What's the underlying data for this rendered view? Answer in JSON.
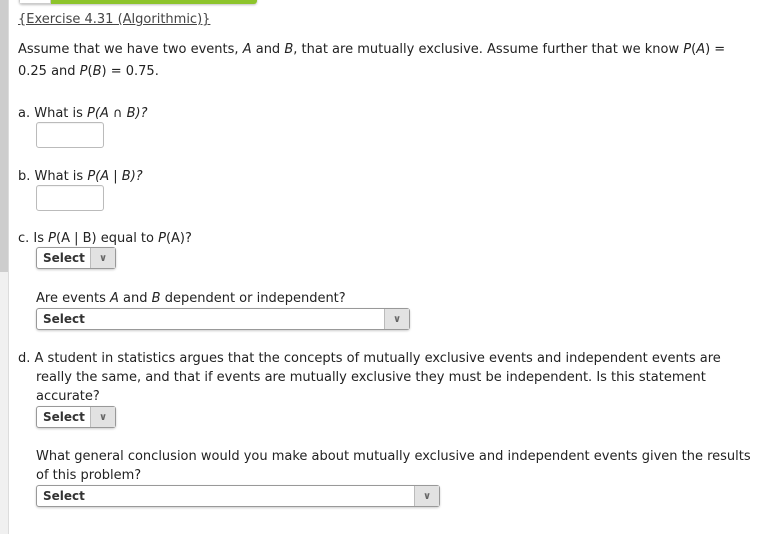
{
  "exercise_title": "{Exercise 4.31 (Algorithmic)}",
  "intro": {
    "t1": "Assume that we have two events, ",
    "A": "A",
    "t2": " and ",
    "B": "B",
    "t3": ", that are mutually exclusive. Assume further that we know ",
    "pa": "P",
    "t4": "(",
    "t5": ") = 0.25 and ",
    "t6": ") = 0.75."
  },
  "questions": {
    "a": {
      "prefix": "a. What is ",
      "P": "P",
      "expr": "(A ∩ B)?",
      "value": ""
    },
    "b": {
      "prefix": "b. What is ",
      "P": "P",
      "expr": "(A | B)?",
      "value": ""
    },
    "c": {
      "prefix": "c. Is ",
      "P1": "P",
      "mid": "(A | B) equal to ",
      "P2": "P",
      "end": "(A)?",
      "select": "Select"
    },
    "c2": {
      "t1": "Are events ",
      "A": "A",
      "t2": " and ",
      "B": "B",
      "t3": " dependent or independent?",
      "select": "Select"
    },
    "d": {
      "text": "d. A student in statistics argues that the concepts of mutually exclusive events and independent events are",
      "text2": "really the same, and that if events are mutually exclusive they must be independent. Is this statement",
      "text3": "accurate?",
      "select": "Select"
    },
    "d2": {
      "text": "What general conclusion would you make about mutually exclusive and independent events given the results",
      "text2": "of this problem?",
      "select": "Select"
    }
  },
  "icons": {
    "dropdown": "chevron-down"
  },
  "colors": {
    "progress_green": "#8dc42b"
  }
}
